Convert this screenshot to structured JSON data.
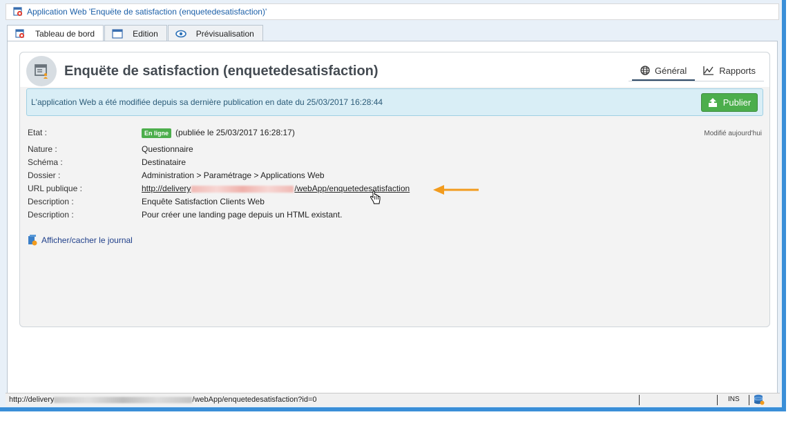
{
  "window": {
    "title": "Application Web 'Enquëte de satisfaction (enquetedesatisfaction)'"
  },
  "tabs": [
    {
      "label": "Tableau de bord",
      "icon": "webapp-icon",
      "active": true
    },
    {
      "label": "Edition",
      "icon": "window-icon",
      "active": false
    },
    {
      "label": "Prévisualisation",
      "icon": "eye-icon",
      "active": false
    }
  ],
  "header": {
    "title": "Enquëte de satisfaction (enquetedesatisfaction)",
    "view_tabs": [
      {
        "label": "Général",
        "icon": "globe-icon",
        "active": true
      },
      {
        "label": "Rapports",
        "icon": "chart-line-icon",
        "active": false
      }
    ]
  },
  "banner": {
    "message": "L'application Web a été modifiée depuis sa dernière publication en date du 25/03/2017 16:28:44",
    "publish_label": "Publier"
  },
  "details": {
    "modified": "Modifié aujourd'hui",
    "state": {
      "label": "Etat :",
      "badge": "En ligne",
      "value": "(publiée le 25/03/2017 16:28:17)"
    },
    "nature": {
      "label": "Nature :",
      "value": "Questionnaire"
    },
    "schema": {
      "label": "Schéma :",
      "value": "Destinataire"
    },
    "folder": {
      "label": "Dossier :",
      "value": "Administration > Paramétrage > Applications Web"
    },
    "url": {
      "label": "URL publique :",
      "prefix": "http://delivery",
      "suffix": "/webApp/enquetedesatisfaction"
    },
    "description1": {
      "label": "Description :",
      "value": "Enquête Satisfaction Clients Web"
    },
    "description2": {
      "label": "Description :",
      "value": "Pour créer une landing page depuis un HTML existant."
    }
  },
  "journal": {
    "label": "Afficher/cacher le journal"
  },
  "statusbar": {
    "url_prefix": "http://delivery",
    "url_suffix": "/webApp/enquetedesatisfaction?id=0",
    "mode": "INS"
  },
  "colors": {
    "accent_blue": "#3a8fd8",
    "publish_green": "#4cae4c",
    "link_red": "#d0302a",
    "arrow_orange": "#f29b1d",
    "banner_bg": "#d9eef6"
  }
}
